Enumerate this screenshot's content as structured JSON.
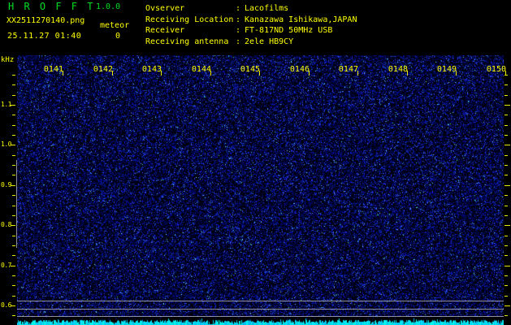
{
  "app": {
    "title": "H R O F F T",
    "version": "1.0.0"
  },
  "file": {
    "name": "XX2511270140.png",
    "mode": "meteor",
    "timestamp": "25.11.27 01:40",
    "echo_count": "0"
  },
  "station": {
    "separator": ":",
    "rows": [
      {
        "label": "Ovserver",
        "value": "Lacofilms"
      },
      {
        "label": "Receiving Location",
        "value": "Kanazawa Ishikawa,JAPAN"
      },
      {
        "label": "Receiver",
        "value": "FT-817ND 50MHz USB"
      },
      {
        "label": "Receiving antenna",
        "value": "2ele HB9CY"
      }
    ]
  },
  "axes": {
    "freq_unit": "kHz",
    "freq_major_labels": [
      "1.1",
      "1.0",
      "0.9",
      "0.8",
      "0.7",
      "0.6"
    ],
    "time_labels": [
      "0141",
      "0142",
      "0143",
      "0144",
      "0145",
      "0146",
      "0147",
      "0148",
      "0149",
      "0150"
    ]
  },
  "colors": {
    "text_yellow": "#ffff00",
    "text_green": "#00dd22",
    "grid_gray": "#a9a9b4",
    "level_cyan": "#00e4ff",
    "noise_blue": "#0000aa"
  }
}
